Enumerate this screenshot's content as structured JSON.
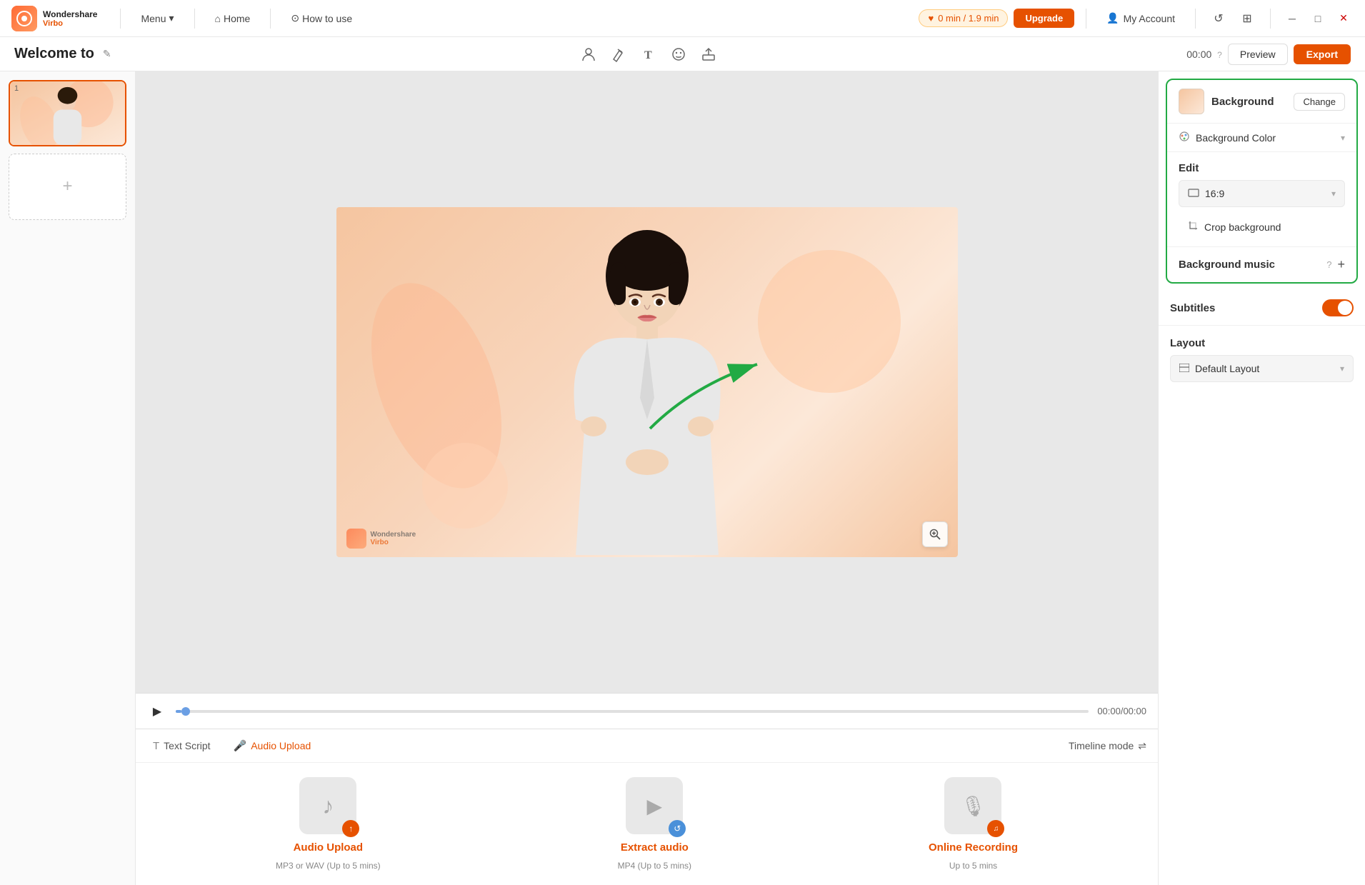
{
  "app": {
    "logo_text": "Wondershare",
    "logo_sub": "Virbo",
    "menu_label": "Menu",
    "home_label": "Home",
    "how_to_use_label": "How to use",
    "timer_text": "0 min / 1.9 min",
    "upgrade_label": "Upgrade",
    "account_label": "My Account",
    "welcome_text": "Welcome to",
    "time_display": "00:00",
    "time_help": "?",
    "preview_label": "Preview",
    "export_label": "Export"
  },
  "toolbar": {
    "icons": [
      "avatar-icon",
      "brush-icon",
      "text-icon",
      "emoji-icon",
      "upload-icon"
    ]
  },
  "slides": [
    {
      "num": "1",
      "active": true
    },
    {
      "num": "+",
      "active": false
    }
  ],
  "canvas": {
    "watermark_brand": "Wondershare",
    "watermark_virbo": "Virbo"
  },
  "playback": {
    "current_time": "00:00/00:00"
  },
  "script_tabs": [
    {
      "label": "Text Script",
      "active": false
    },
    {
      "label": "Audio Upload",
      "active": true
    }
  ],
  "timeline_mode_label": "Timeline mode",
  "audio_cards": [
    {
      "title": "Audio Upload",
      "subtitle": "MP3 or WAV (Up to 5 mins)",
      "badge": "upload",
      "badge_color": "orange"
    },
    {
      "title": "Extract audio",
      "subtitle": "MP4 (Up to 5 mins)",
      "badge": "refresh",
      "badge_color": "blue"
    },
    {
      "title": "Online Recording",
      "subtitle": "Up to 5 mins",
      "badge": "mic",
      "badge_color": "orange"
    }
  ],
  "right_panel": {
    "background_label": "Background",
    "change_label": "Change",
    "background_color_label": "Background Color",
    "edit_label": "Edit",
    "ratio_label": "16:9",
    "crop_background_label": "Crop background",
    "background_music_label": "Background music",
    "subtitles_label": "Subtitles",
    "layout_label": "Layout",
    "default_layout_label": "Default Layout"
  }
}
